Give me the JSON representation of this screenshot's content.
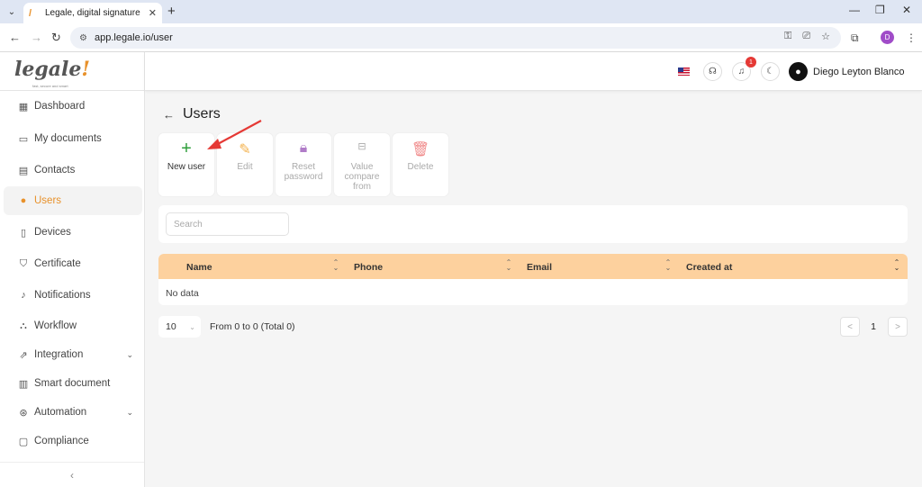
{
  "browser": {
    "tab_title": "Legale, digital signature",
    "url": "app.legale.io/user",
    "profile_initial": "D"
  },
  "sidebar": {
    "logo_text": "legale",
    "logo_mark": "!",
    "logo_tagline": "fast, secure and smart",
    "items": [
      {
        "label": "Dashboard",
        "icon": "dashboard-icon"
      },
      {
        "label": "My documents",
        "icon": "folder-icon"
      },
      {
        "label": "Contacts",
        "icon": "contacts-icon"
      },
      {
        "label": "Users",
        "icon": "user-icon",
        "active": true
      },
      {
        "label": "Devices",
        "icon": "tablet-icon"
      },
      {
        "label": "Certificate",
        "icon": "shield-icon"
      },
      {
        "label": "Notifications",
        "icon": "bell-icon"
      },
      {
        "label": "Workflow",
        "icon": "workflow-icon"
      },
      {
        "label": "Integration",
        "icon": "external-link-icon",
        "expandable": true
      },
      {
        "label": "Smart document",
        "icon": "smart-document-icon"
      },
      {
        "label": "Automation",
        "icon": "automation-icon",
        "expandable": true
      },
      {
        "label": "Compliance",
        "icon": "chat-icon"
      }
    ],
    "collapse_label": "‹"
  },
  "header": {
    "notification_count": "1",
    "username": "Diego Leyton Blanco"
  },
  "page": {
    "title": "Users"
  },
  "toolbar": {
    "new_user": "New user",
    "edit": "Edit",
    "reset_password": "Reset password",
    "value_compare_from": "Value compare from",
    "delete": "Delete"
  },
  "search": {
    "placeholder": "Search"
  },
  "table": {
    "columns": [
      "Name",
      "Phone",
      "Email",
      "Created at"
    ],
    "empty_text": "No data"
  },
  "pagination": {
    "page_size": "10",
    "info": "From 0 to 0 (Total 0)",
    "current_page": "1",
    "prev": "<",
    "next": ">"
  },
  "colors": {
    "accent": "#e8912a",
    "table_header": "#fdd19e",
    "new_user_icon": "#2e9e3a",
    "edit_icon": "#f3b24e",
    "reset_icon": "#b07cc8",
    "delete_icon": "#f08a8a",
    "annotation_arrow": "#e53935"
  }
}
